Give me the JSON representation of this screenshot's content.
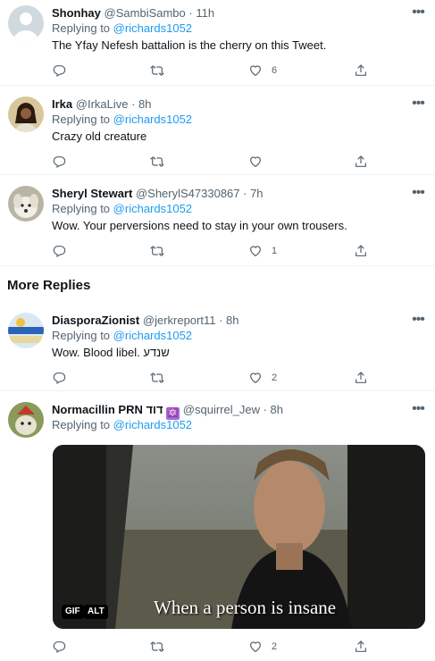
{
  "tweets": [
    {
      "name": "Shonhay",
      "handle": "@SambiSambo",
      "time": "· 11h",
      "replying_prefix": "Replying to",
      "replying_to": "@richards1052",
      "text": "The Yfay Nefesh battalion is the cherry on this Tweet.",
      "likes": "6"
    },
    {
      "name": "Irka",
      "handle": "@IrkaLive",
      "time": "· 8h",
      "replying_prefix": "Replying to",
      "replying_to": "@richards1052",
      "text": "Crazy old creature",
      "likes": ""
    },
    {
      "name": "Sheryl Stewart",
      "handle": "@SherylS47330867",
      "time": "· 7h",
      "replying_prefix": "Replying to",
      "replying_to": "@richards1052",
      "text": "Wow. Your perversions need to stay in your own trousers.",
      "likes": "1"
    }
  ],
  "section_title": "More Replies",
  "more_tweets": [
    {
      "name": "DiasporaZionist",
      "handle": "@jerkreport11",
      "time": "· 8h",
      "replying_prefix": "Replying to",
      "replying_to": "@richards1052",
      "text": "Wow.  Blood libel.  שנדע",
      "likes": "2"
    },
    {
      "name": "Normacillin PRN דוד",
      "name_emoji": "🔯",
      "handle": "@squirrel_Jew",
      "time": "· 8h",
      "replying_prefix": "Replying to",
      "replying_to": "@richards1052",
      "media_caption": "When a person is insane",
      "gif_badge": "GIF",
      "alt_badge": "ALT",
      "likes": "2"
    }
  ],
  "colors": {
    "link": "#1d9bf0",
    "secondary": "#536471",
    "text": "#0f1419"
  },
  "icons": [
    "more-icon",
    "reply-icon",
    "retweet-icon",
    "like-icon",
    "share-icon"
  ]
}
